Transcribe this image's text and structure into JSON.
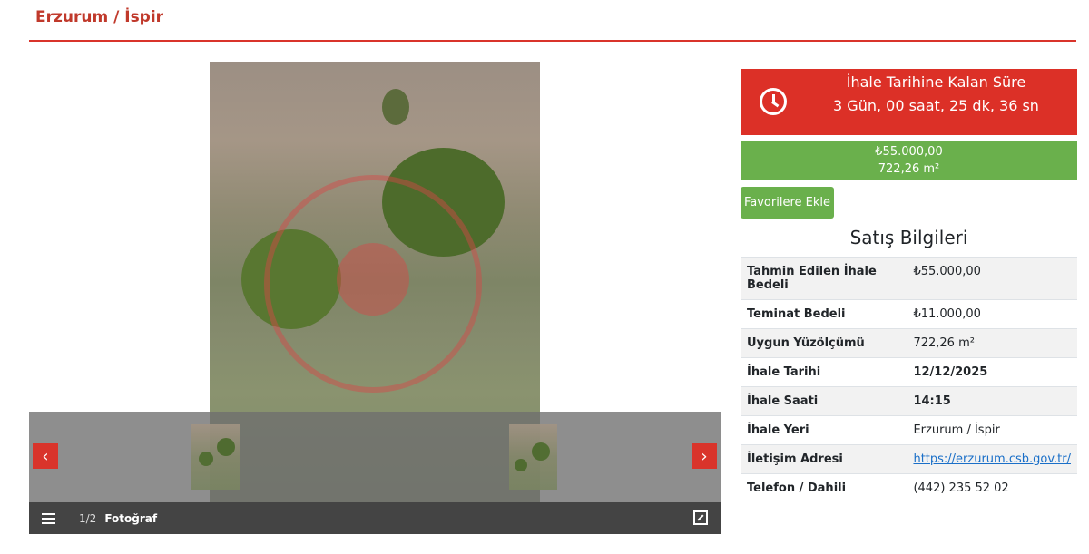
{
  "page": {
    "title": "Erzurum / İspir"
  },
  "gallery": {
    "counter": "1/2",
    "label": "Fotoğraf"
  },
  "countdown": {
    "title": "İhale Tarihine Kalan Süre",
    "value": "3 Gün, 00 saat, 25 dk, 36 sn"
  },
  "price": {
    "amount": "₺55.000,00",
    "area": "722,26 m²"
  },
  "favorite_button": "Favorilere Ekle",
  "sales": {
    "title": "Satış Bilgileri",
    "rows": [
      {
        "label": "Tahmin Edilen İhale Bedeli",
        "value": "₺55.000,00"
      },
      {
        "label": "Teminat Bedeli",
        "value": "₺11.000,00"
      },
      {
        "label": "Uygun Yüzölçümü",
        "value": "722,26 m²"
      },
      {
        "label": "İhale Tarihi",
        "value": "12/12/2025"
      },
      {
        "label": "İhale Saati",
        "value": "14:15"
      },
      {
        "label": "İhale Yeri",
        "value": "Erzurum / İspir"
      },
      {
        "label": "İletişim Adresi",
        "value": "https://erzurum.csb.gov.tr/"
      },
      {
        "label": "Telefon / Dahili",
        "value": "(442) 235 52 02"
      }
    ]
  },
  "colors": {
    "accent_red": "#dc3027",
    "accent_green": "#6ab04c",
    "link": "#1a6fc8"
  },
  "icons": [
    "clock-icon",
    "chevron-left-icon",
    "chevron-right-icon",
    "list-icon",
    "fullscreen-icon"
  ]
}
